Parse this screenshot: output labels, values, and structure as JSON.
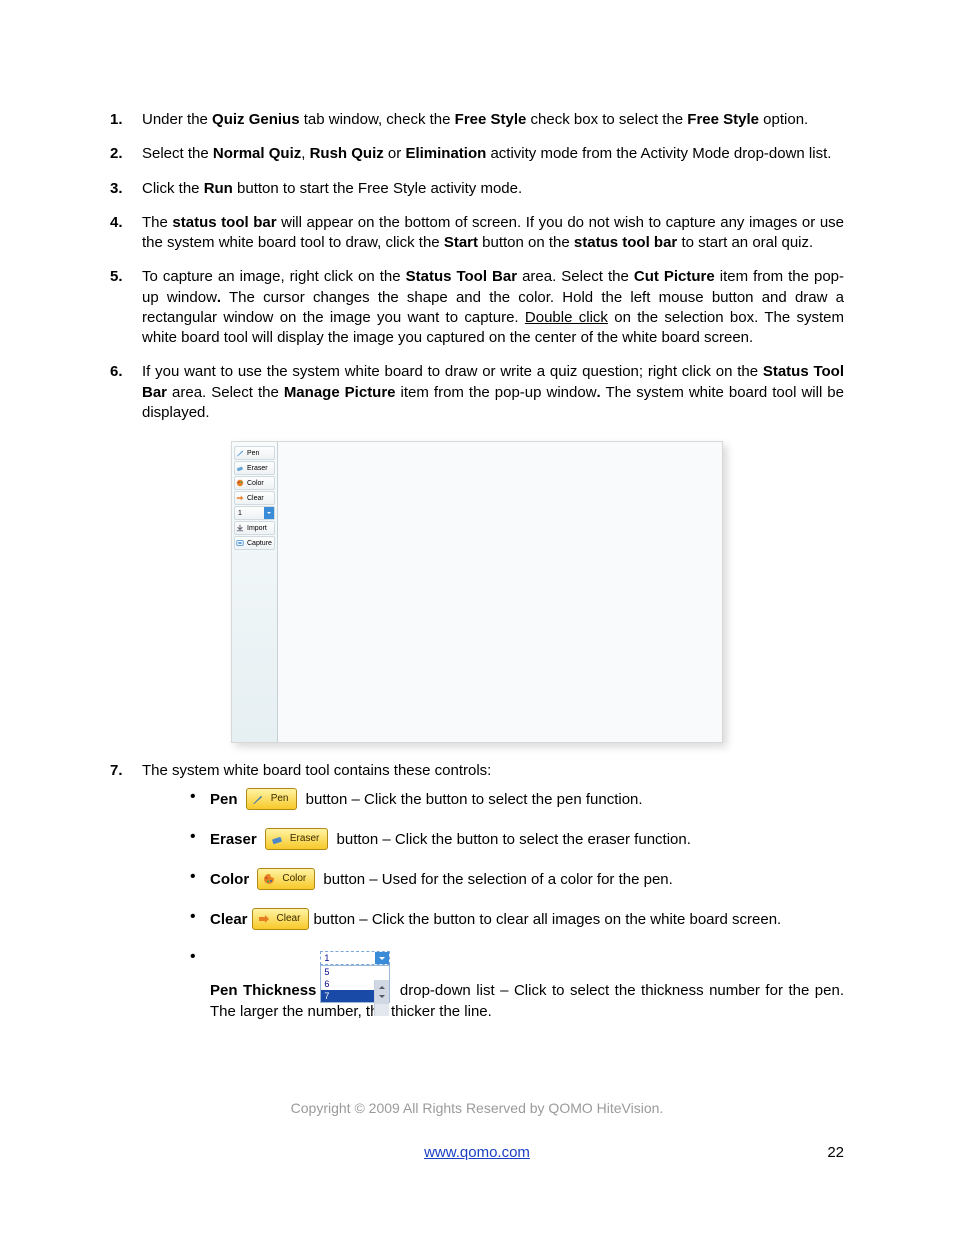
{
  "steps": {
    "s1": {
      "num": "1.",
      "parts": [
        "Under the ",
        "Quiz Genius",
        " tab window, check the ",
        "Free Style",
        " check box to select the ",
        "Free Style",
        " option."
      ]
    },
    "s2": {
      "num": "2.",
      "parts": [
        "Select the ",
        "Normal Quiz",
        ", ",
        "Rush Quiz",
        " or ",
        "Elimination",
        " activity mode from the Activity Mode drop-down list."
      ]
    },
    "s3": {
      "num": "3.",
      "parts": [
        "Click the ",
        "Run",
        " button to start the Free Style activity mode."
      ]
    },
    "s4": {
      "num": "4.",
      "parts": [
        "The ",
        "status tool bar",
        " will appear on the bottom of screen. If you do not wish to capture any images or use the system white board tool to draw, click the ",
        "Start",
        " button on the ",
        "status tool bar",
        " to start an oral quiz."
      ]
    },
    "s5": {
      "num": "5.",
      "pre": "To capture an image, right click on the ",
      "b1": "Status Tool Bar",
      "mid1": " area. Select the ",
      "b2": "Cut Picture",
      "mid2": " item from the pop-up window",
      "dot": ".",
      "mid3": " The cursor changes the shape and the color. Hold the left mouse button and draw a rectangular window on the image you want to capture. ",
      "u1": "Double click",
      "post": " on the selection box. The system white board tool will display the image you captured on the center of the white board screen."
    },
    "s6": {
      "num": "6.",
      "pre": "If you want to use the system white board to draw or write a quiz question;  right click on the ",
      "b1": "Status Tool Bar",
      "mid1": " area. Select the ",
      "b2": "Manage Picture",
      "mid2": " item from the pop-up window",
      "dot": ".",
      "post": " The system white board tool will be displayed."
    },
    "s7": {
      "num": "7.",
      "text": "The system white board tool contains these controls:"
    }
  },
  "whiteboard": {
    "items": [
      "Pen",
      "Eraser",
      "Color",
      "Clear",
      "1",
      "Import",
      "Capture"
    ]
  },
  "controls": {
    "pen": {
      "name": "Pen",
      "btn": "Pen",
      "desc": " button – Click the button to select the pen function."
    },
    "eraser": {
      "name": "Eraser",
      "btn": "Eraser",
      "desc": " button – Click the button to select the eraser function."
    },
    "color": {
      "name": "Color",
      "btn": "Color",
      "desc": " button – Used for the selection of a color for the pen."
    },
    "clear": {
      "name": "Clear",
      "btn": "Clear",
      "desc": "button – Click the button to clear all images on the white board screen."
    },
    "thickness": {
      "name": "Pen Thickness",
      "desc": " drop-down list – Click to select the thickness number for the pen. The larger the number, the thicker the line.",
      "selected": "1",
      "options": [
        "5",
        "6",
        "7"
      ]
    }
  },
  "footer": {
    "copyright": "Copyright © 2009 All Rights Reserved by QOMO HiteVision.",
    "url": "www.qomo.com",
    "page": "22"
  }
}
